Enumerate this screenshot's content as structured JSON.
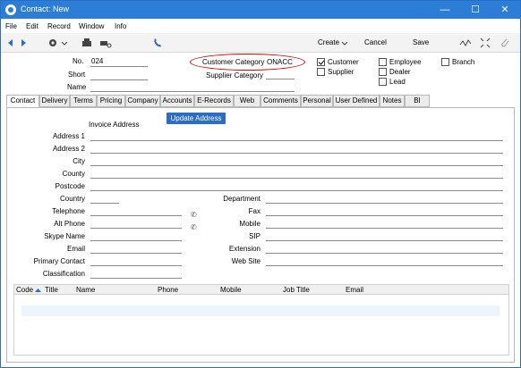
{
  "window": {
    "title": "Contact: New",
    "controls": [
      "minimize",
      "maximize",
      "close"
    ]
  },
  "menu": [
    "File",
    "Edit",
    "Record",
    "Window",
    "Info"
  ],
  "toolbar": {
    "create": "Create",
    "cancel": "Cancel",
    "save": "Save"
  },
  "header": {
    "no_label": "No.",
    "no_value": "024",
    "short_label": "Short",
    "short_value": "",
    "name_label": "Name",
    "name_value": "",
    "cust_cat_label": "Customer Category",
    "cust_cat_value": "ONACC",
    "supp_cat_label": "Supplier Category",
    "supp_cat_value": "",
    "customer": {
      "label": "Customer",
      "checked": true
    },
    "supplier": {
      "label": "Supplier",
      "checked": false
    },
    "employee": {
      "label": "Employee",
      "checked": false
    },
    "dealer": {
      "label": "Dealer",
      "checked": false
    },
    "lead": {
      "label": "Lead",
      "checked": false
    },
    "branch": {
      "label": "Branch",
      "checked": false
    }
  },
  "tabs": [
    "Contact",
    "Delivery",
    "Terms",
    "Pricing",
    "Company",
    "Accounts",
    "E-Records",
    "Web",
    "Comments",
    "Personal",
    "User Defined",
    "Notes",
    "BI"
  ],
  "active_tab": "Contact",
  "contact": {
    "invoice_address": "Invoice Address",
    "update_address": "Update Address",
    "address1": "Address 1",
    "address2": "Address 2",
    "city": "City",
    "county": "County",
    "postcode": "Postcode",
    "country": "Country",
    "telephone": "Telephone",
    "alt_phone": "Alt Phone",
    "skype": "Skype Name",
    "email": "Email",
    "primary_contact": "Primary Contact",
    "classification": "Classification",
    "department": "Department",
    "fax": "Fax",
    "mobile": "Mobile",
    "sip": "SIP",
    "extension": "Extension",
    "website": "Web Site"
  },
  "grid": {
    "columns": [
      "Code",
      "Title",
      "Name",
      "Phone",
      "Mobile",
      "Job Title",
      "Email"
    ],
    "rows": []
  }
}
